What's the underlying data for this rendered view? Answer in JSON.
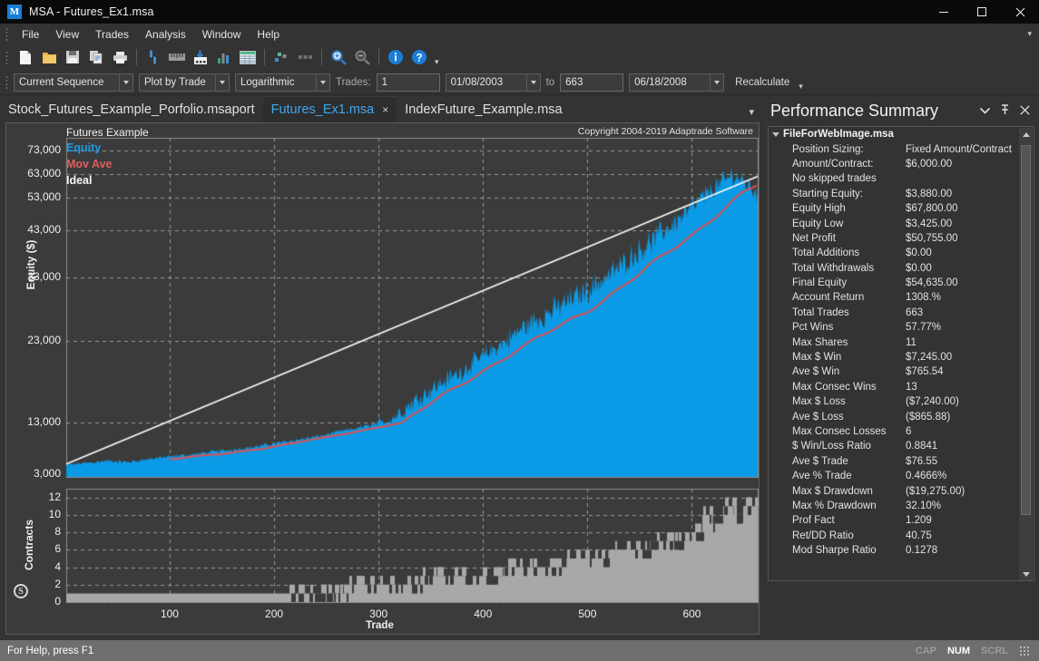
{
  "window": {
    "title": "MSA - Futures_Ex1.msa",
    "logo_text": "M",
    "minimize_label": "Minimize",
    "maximize_label": "Maximize",
    "close_label": "Close"
  },
  "menu": {
    "items": [
      "File",
      "View",
      "Trades",
      "Analysis",
      "Window",
      "Help"
    ],
    "overflow": "▾"
  },
  "toolbar1": {
    "icons": [
      "new-file-icon",
      "open-folder-icon",
      "save-icon",
      "copy-icon",
      "print-icon",
      "trade-plot-icon",
      "ruler-icon",
      "import-data-icon",
      "bar-chart-icon",
      "table-icon",
      "scatter-icon",
      "dots-icon",
      "zoom-in-icon",
      "zoom-out-icon",
      "info-icon",
      "help-icon"
    ],
    "overflow": "▾"
  },
  "toolbar2": {
    "sequence_combo": "Current Sequence",
    "plot_combo": "Plot by Trade",
    "scale_combo": "Logarithmic",
    "trades_label": "Trades:",
    "trade_from": "1",
    "date_from": "01/08/2003",
    "to_label": "to",
    "trade_to": "663",
    "date_to": "06/18/2008",
    "recalculate": "Recalculate",
    "overflow": "▾"
  },
  "tabs": {
    "items": [
      {
        "label": "Stock_Futures_Example_Porfolio.msaport",
        "active": false,
        "closable": false
      },
      {
        "label": "Futures_Ex1.msa",
        "active": true,
        "closable": true
      },
      {
        "label": "IndexFuture_Example.msa",
        "active": false,
        "closable": false
      }
    ],
    "close_glyph": "×",
    "overflow": "▾"
  },
  "chart_data": {
    "type": "area",
    "title": "Futures Example",
    "copyright": "Copyright 2004-2019 Adaptrade Software",
    "xlabel": "Trade",
    "ylabel": "Equity ($)",
    "ylabel2": "Contracts",
    "yscale": "log",
    "grid": true,
    "legend_position": "top-left",
    "legend": [
      {
        "name": "Equity",
        "color": "#0b9ae6"
      },
      {
        "name": "Mov Ave",
        "color": "#e05050"
      },
      {
        "name": "Ideal",
        "color": "#ffffff"
      }
    ],
    "xlim": [
      1,
      663
    ],
    "xticks": [
      100,
      200,
      300,
      400,
      500,
      600
    ],
    "ylim": [
      3000,
      73000
    ],
    "yticks": [
      73000,
      63000,
      53000,
      43000,
      33000,
      23000,
      13000,
      3000
    ],
    "yticklabels": [
      "73,000",
      "63,000",
      "53,000",
      "43,000",
      "33,000",
      "23,000",
      "13,000",
      "3,000"
    ],
    "subplot": {
      "type": "area",
      "ylabel": "Contracts",
      "ylim": [
        0,
        13
      ],
      "yticks": [
        0,
        2,
        4,
        6,
        8,
        10,
        12
      ],
      "yticklabels": [
        "0",
        "2",
        "4",
        "6",
        "8",
        "10",
        "12"
      ],
      "series_name": "Contracts",
      "color": "#a8a8a8",
      "x": [
        1,
        60,
        120,
        180,
        240,
        270,
        290,
        300,
        320,
        340,
        360,
        380,
        400,
        420,
        440,
        460,
        480,
        500,
        520,
        540,
        560,
        580,
        600,
        610,
        620,
        630,
        640,
        650,
        663
      ],
      "values": [
        1,
        1,
        1,
        1,
        1,
        2,
        2,
        2,
        2,
        3,
        3,
        3,
        3,
        4,
        4,
        4,
        5,
        5,
        6,
        6,
        7,
        7,
        8,
        10,
        9,
        11,
        10,
        11,
        11
      ]
    },
    "series": [
      {
        "name": "Equity",
        "color": "#0b9ae6",
        "x": [
          1,
          20,
          40,
          60,
          80,
          100,
          120,
          140,
          160,
          180,
          200,
          220,
          240,
          260,
          280,
          300,
          320,
          340,
          360,
          380,
          400,
          420,
          440,
          460,
          480,
          500,
          520,
          540,
          560,
          580,
          600,
          620,
          640,
          663
        ],
        "values": [
          3880,
          4100,
          4350,
          4200,
          4600,
          4900,
          5200,
          5600,
          6000,
          6400,
          7100,
          7800,
          8600,
          9800,
          11000,
          12500,
          13800,
          15500,
          17000,
          18500,
          20500,
          22500,
          24800,
          26500,
          28500,
          30500,
          33000,
          36500,
          40000,
          44000,
          49000,
          56000,
          62000,
          54635
        ]
      },
      {
        "name": "Mov Ave",
        "color": "#e05050",
        "x": [
          100,
          150,
          200,
          250,
          300,
          350,
          400,
          450,
          500,
          550,
          600,
          650,
          663
        ],
        "values": [
          4600,
          5300,
          6600,
          8500,
          11500,
          14800,
          18800,
          23000,
          27500,
          33500,
          42000,
          55000,
          58000
        ]
      },
      {
        "name": "Ideal",
        "color": "#ffffff",
        "x": [
          1,
          663
        ],
        "values": [
          4000,
          62000
        ]
      }
    ]
  },
  "performance": {
    "panel_title": "Performance Summary",
    "dropdown_icon": "chevron-down-icon",
    "pin_icon": "pin-icon",
    "close_icon": "close-icon",
    "file_name": "FileForWebImage.msa",
    "rows": [
      {
        "key": "Position Sizing:",
        "value": "Fixed Amount/Contract"
      },
      {
        "key": "Amount/Contract:",
        "value": "$6,000.00"
      },
      {
        "key": "No skipped trades",
        "value": ""
      },
      {
        "key": "Starting Equity:",
        "value": "$3,880.00"
      },
      {
        "key": "Equity High",
        "value": "$67,800.00"
      },
      {
        "key": "Equity Low",
        "value": "$3,425.00"
      },
      {
        "key": "Net Profit",
        "value": "$50,755.00"
      },
      {
        "key": "Total Additions",
        "value": "$0.00"
      },
      {
        "key": "Total Withdrawals",
        "value": "$0.00"
      },
      {
        "key": "Final Equity",
        "value": "$54,635.00"
      },
      {
        "key": "Account Return",
        "value": "1308.%"
      },
      {
        "key": "Total Trades",
        "value": "663"
      },
      {
        "key": "Pct Wins",
        "value": "57.77%"
      },
      {
        "key": "Max Shares",
        "value": "11"
      },
      {
        "key": "Max $ Win",
        "value": "$7,245.00"
      },
      {
        "key": "Ave $ Win",
        "value": "$765.54"
      },
      {
        "key": "Max Consec Wins",
        "value": "13"
      },
      {
        "key": "Max $ Loss",
        "value": "($7,240.00)"
      },
      {
        "key": "Ave $ Loss",
        "value": "($865.88)"
      },
      {
        "key": "Max Consec Losses",
        "value": "6"
      },
      {
        "key": "$ Win/Loss Ratio",
        "value": "0.8841"
      },
      {
        "key": "Ave $ Trade",
        "value": "$76.55"
      },
      {
        "key": "Ave % Trade",
        "value": "0.4666%"
      },
      {
        "key": "Max $ Drawdown",
        "value": "($19,275.00)"
      },
      {
        "key": "Max % Drawdown",
        "value": "32.10%"
      },
      {
        "key": "Prof Fact",
        "value": "1.209"
      },
      {
        "key": "Ret/DD Ratio",
        "value": "40.75"
      },
      {
        "key": "Mod Sharpe Ratio",
        "value": "0.1278"
      }
    ]
  },
  "statusbar": {
    "message": "For Help, press F1",
    "indicators": [
      {
        "label": "CAP",
        "on": false
      },
      {
        "label": "NUM",
        "on": true
      },
      {
        "label": "SCRL",
        "on": false
      }
    ]
  }
}
